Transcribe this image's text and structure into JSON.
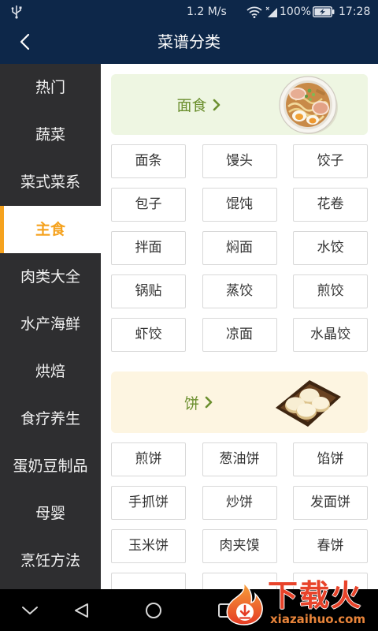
{
  "status_bar": {
    "network_speed": "1.2 M/s",
    "battery_percent": "100%",
    "time": "17:28",
    "icons": {
      "usb": "usb-icon",
      "wifi": "wifi-icon",
      "signal": "signal-icon",
      "battery": "battery-charging-icon"
    }
  },
  "header": {
    "title": "菜谱分类",
    "back_icon": "back-arrow-icon"
  },
  "sidebar": {
    "selected_index": 3,
    "items": [
      "热门",
      "蔬菜",
      "菜式菜系",
      "主食",
      "肉类大全",
      "水产海鲜",
      "烘焙",
      "食疗养生",
      "蛋奶豆制品",
      "母婴",
      "烹饪方法"
    ]
  },
  "sections": [
    {
      "title": "面食",
      "chevron_icon": "chevron-right-icon",
      "image_icon": "ramen-bowl-image",
      "items": [
        "面条",
        "馒头",
        "饺子",
        "包子",
        "馄饨",
        "花卷",
        "拌面",
        "焖面",
        "水饺",
        "锅贴",
        "蒸饺",
        "煎饺",
        "虾饺",
        "凉面",
        "水晶饺"
      ]
    },
    {
      "title": "饼",
      "chevron_icon": "chevron-right-icon",
      "image_icon": "buns-plate-image",
      "items": [
        "煎饼",
        "葱油饼",
        "馅饼",
        "手抓饼",
        "炒饼",
        "发面饼",
        "玉米饼",
        "肉夹馍",
        "春饼"
      ]
    }
  ],
  "nav_bar": {
    "icons": [
      "collapse-chevron-icon",
      "back-triangle-icon",
      "home-circle-icon",
      "recents-square-icon"
    ]
  },
  "watermark": {
    "brand": "下载火",
    "site": "xiazaihuo.com",
    "logo_icon": "flame-download-logo-icon"
  },
  "colors": {
    "header_bg": "#0d2749",
    "sidebar_bg": "#2e2e30",
    "accent": "#f5a21e",
    "section_title": "#6b8f2e",
    "banner_green": "#eef6e2",
    "banner_cream": "#fdf5e1",
    "cell_border": "#d8d8d8",
    "watermark_red": "#e8432a"
  }
}
